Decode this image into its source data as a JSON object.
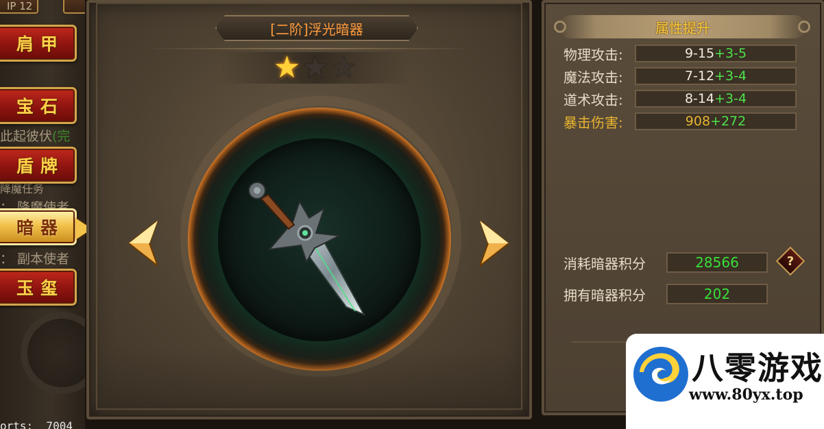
{
  "left_tabs": {
    "items": [
      {
        "label": "肩甲",
        "active": false
      },
      {
        "label": "宝石",
        "active": false
      },
      {
        "label": "盾牌",
        "active": false
      },
      {
        "label": "暗器",
        "active": true
      },
      {
        "label": "玉玺",
        "active": false
      }
    ],
    "background_text": {
      "line1_main": "此起彼伏",
      "line1_status": "(完",
      "line2": "降魔任务",
      "line3": "：  降魔使者",
      "line4": "：  副本使者"
    },
    "top_stub_text": "IP 12"
  },
  "debug_text": "orts:  7004",
  "equipment": {
    "title": "[二阶]浮光暗器",
    "stars_filled": 1,
    "stars_total": 3
  },
  "attributes": {
    "header": "属性提升",
    "rows": [
      {
        "label": "物理攻击:",
        "base": "9-15",
        "bonus": "+3-5",
        "highlight": false
      },
      {
        "label": "魔法攻击:",
        "base": "7-12",
        "bonus": "+3-4",
        "highlight": false
      },
      {
        "label": "道术攻击:",
        "base": "8-14",
        "bonus": "+3-4",
        "highlight": false
      },
      {
        "label": "暴击伤害:",
        "base": "908",
        "bonus": "+272",
        "highlight": true
      }
    ]
  },
  "points": {
    "consume_label": "消耗暗器积分",
    "consume_value": "28566",
    "owned_label": "拥有暗器积分",
    "owned_value": "202",
    "help_symbol": "?"
  },
  "watermark": {
    "name": "八零游戏",
    "url": "www.80yx.top"
  },
  "colors": {
    "tab_red": "#8e1410",
    "tab_gold_text": "#ffd24a",
    "title_orange": "#ff9a3c",
    "bonus_green": "#4ee24a",
    "highlight_gold": "#e8b430"
  },
  "icons": {
    "star": "star-icon",
    "nav_left": "arrow-left-icon",
    "nav_right": "arrow-right-icon",
    "item": "dagger-icon",
    "help": "question-icon"
  }
}
